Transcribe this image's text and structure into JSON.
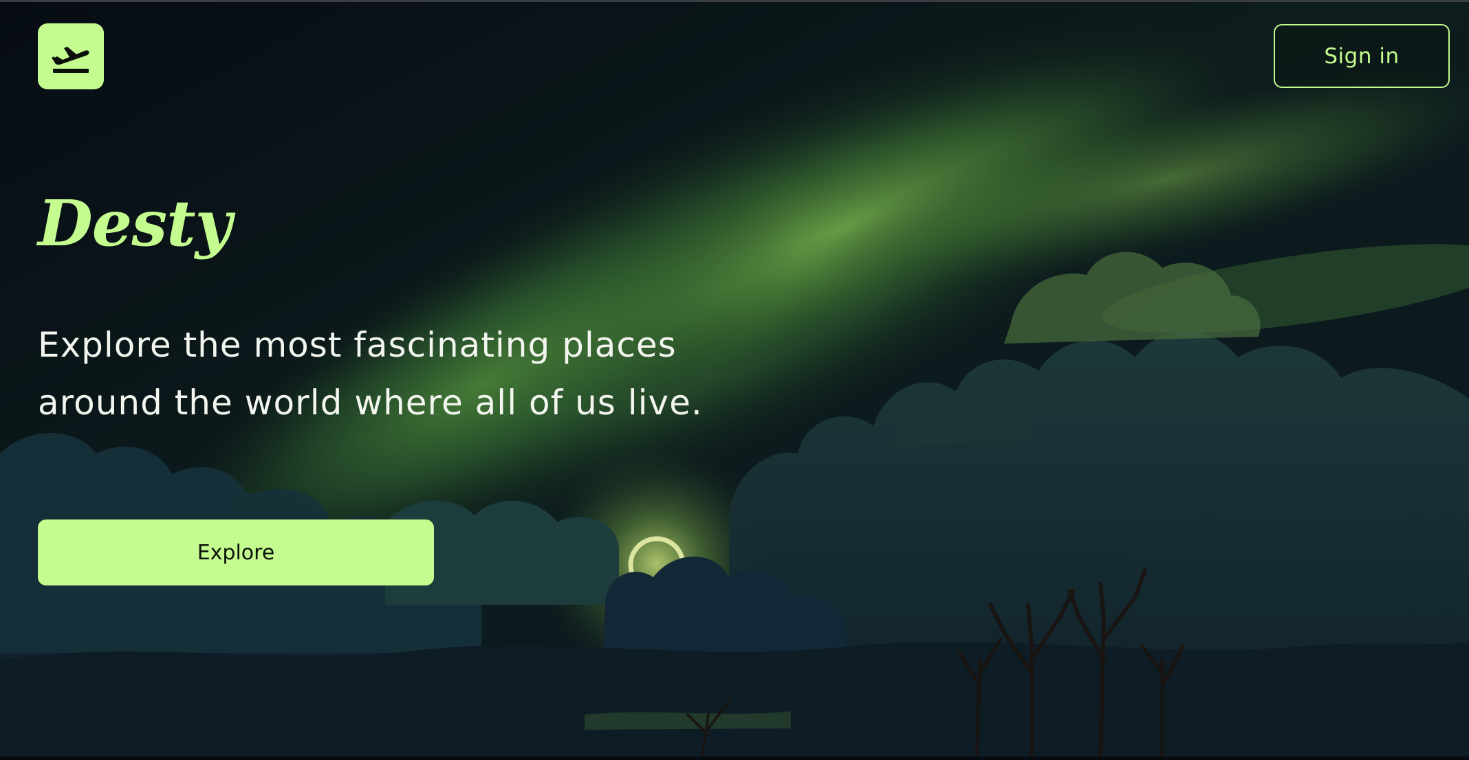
{
  "header": {
    "logo_icon": "airplane-departure-icon",
    "signin_label": "Sign in"
  },
  "hero": {
    "brand": "Desty",
    "tagline": "Explore the most fascinating places around the world where all of us live.",
    "cta_label": "Explore",
    "background": "painted-night-sky-with-green-aurora-clouds-and-bare-trees"
  },
  "colors": {
    "accent": "#c4fc8f",
    "text": "#f3f5ef",
    "background": "#0a0f18"
  }
}
